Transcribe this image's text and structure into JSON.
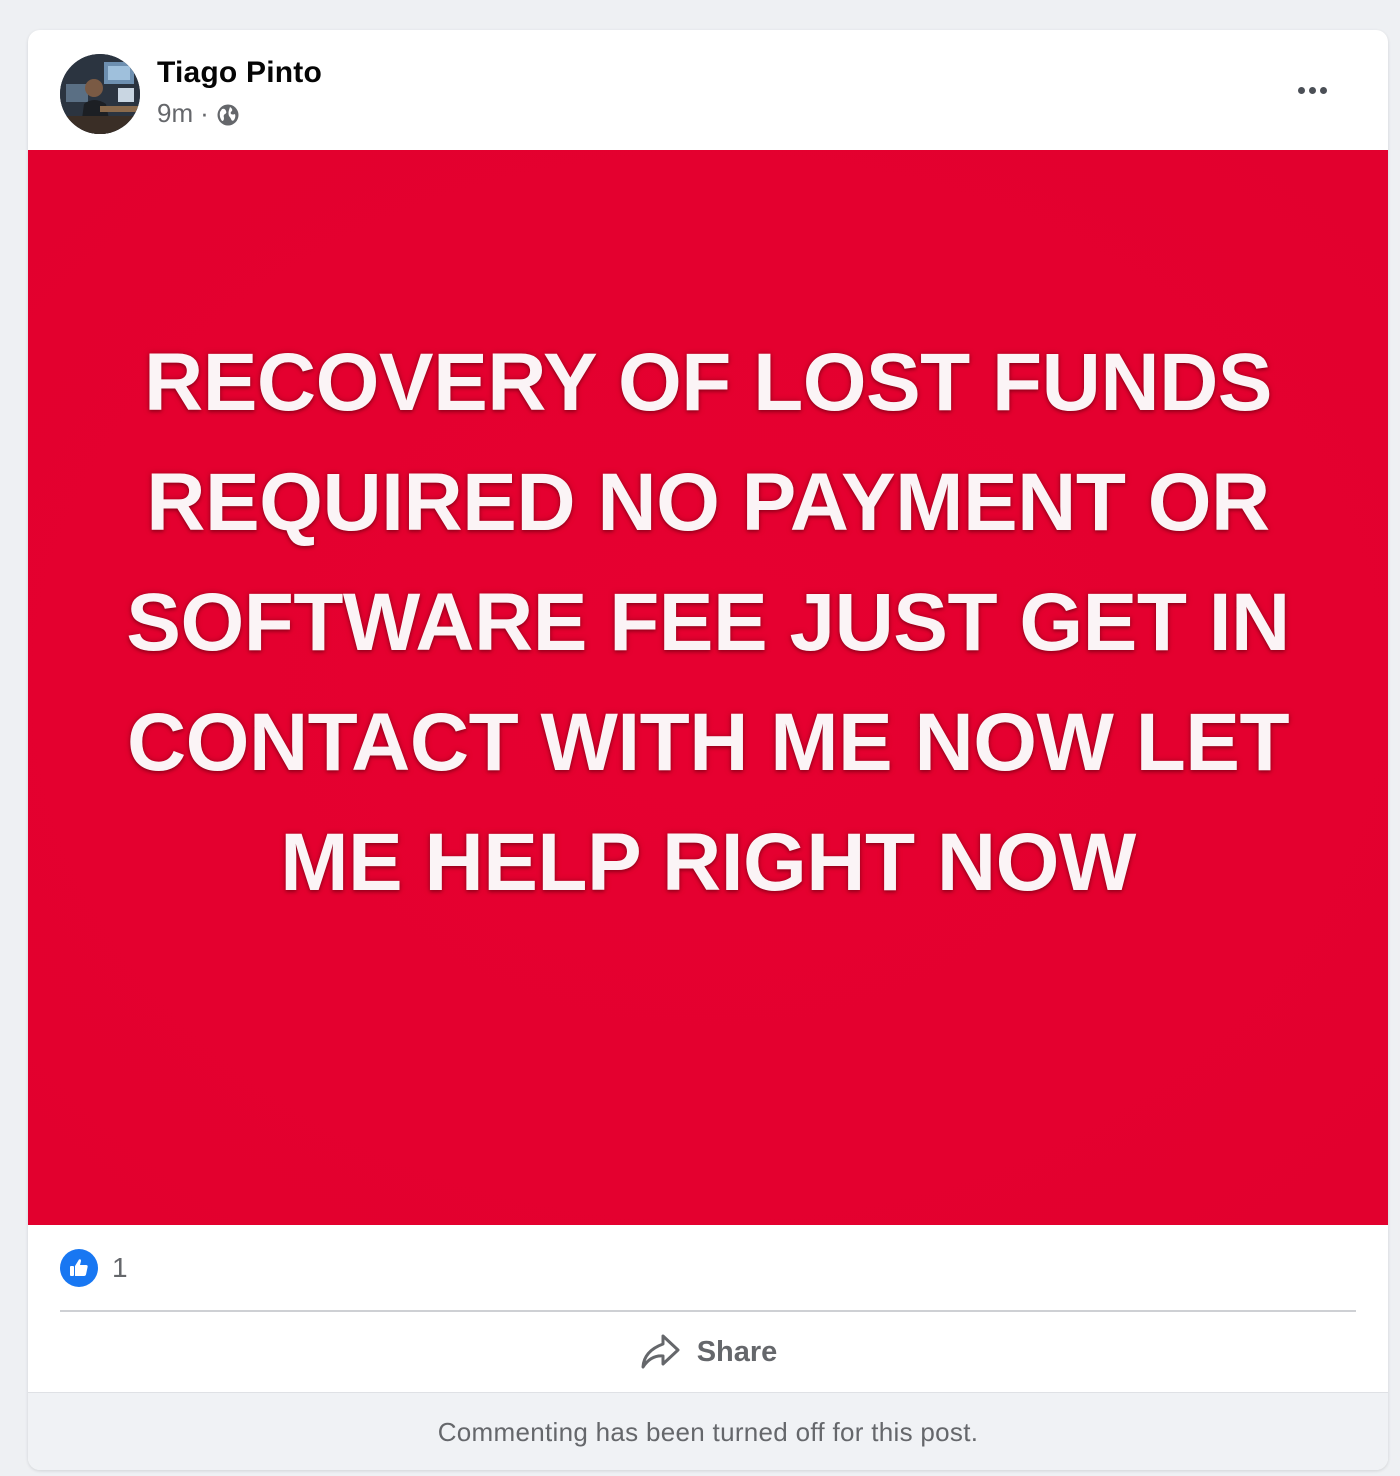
{
  "post": {
    "author_name": "Tiago Pinto",
    "timestamp": "9m",
    "separator": "·",
    "audience_icon": "globe-icon",
    "more_icon": "more-options-icon",
    "image_text": "RECOVERY OF LOST FUNDS REQUIRED NO PAYMENT OR SOFTWARE FEE JUST GET IN CONTACT WITH ME  NOW LET ME HELP RIGHT NOW",
    "image_background_color": "#e4002f",
    "reactions": {
      "icon": "like-icon",
      "count": "1"
    },
    "actions": {
      "share_label": "Share",
      "share_icon": "share-icon"
    },
    "comment_notice": "Commenting has been turned off for this post."
  },
  "colors": {
    "like_blue": "#1877f2",
    "secondary_text": "#65676b",
    "page_background": "#eef0f3"
  }
}
